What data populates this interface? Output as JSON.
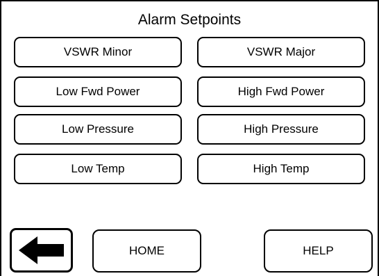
{
  "screen": {
    "title": "Alarm Setpoints"
  },
  "setpoints": [
    {
      "label": "VSWR Minor"
    },
    {
      "label": "VSWR Major"
    },
    {
      "label": "Low Fwd Power"
    },
    {
      "label": "High Fwd Power"
    },
    {
      "label": "Low Pressure"
    },
    {
      "label": "High Pressure"
    },
    {
      "label": "Low Temp"
    },
    {
      "label": "High Temp"
    }
  ],
  "nav": {
    "back_icon": "arrow-left-icon",
    "home_label": "HOME",
    "help_label": "HELP"
  }
}
